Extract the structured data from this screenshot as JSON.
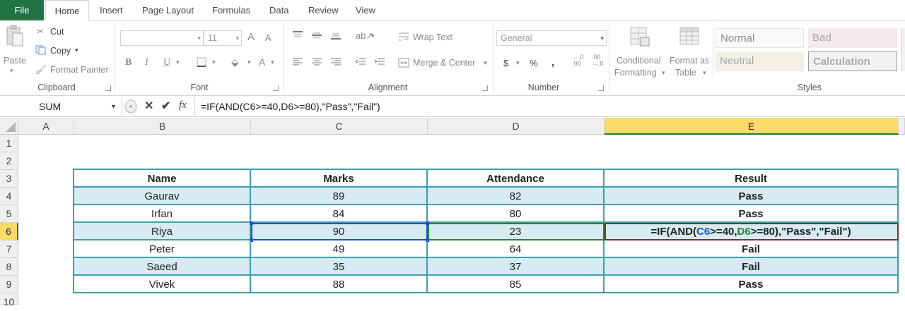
{
  "tabs": {
    "file": "File",
    "home": "Home",
    "insert": "Insert",
    "page_layout": "Page Layout",
    "formulas": "Formulas",
    "data": "Data",
    "review": "Review",
    "view": "View"
  },
  "ribbon": {
    "clipboard": {
      "paste": "Paste",
      "cut": "Cut",
      "copy": "Copy",
      "format_painter": "Format Painter",
      "label": "Clipboard"
    },
    "font": {
      "font_size": "11",
      "grow": "A",
      "shrink": "A",
      "bold": "B",
      "italic": "I",
      "underline": "U",
      "font_color": "A",
      "label": "Font"
    },
    "alignment": {
      "wrap_text": "Wrap Text",
      "merge_center": "Merge & Center",
      "label": "Alignment"
    },
    "number": {
      "format": "General",
      "currency": "$",
      "percent": "%",
      "comma": ",",
      "increase_decimal": "←.0\n.00",
      "decrease_decimal": ".00\n→.0",
      "label": "Number"
    },
    "styles": {
      "conditional_formatting_1": "Conditional",
      "conditional_formatting_2": "Formatting",
      "format_as_table_1": "Format as",
      "format_as_table_2": "Table",
      "normal": "Normal",
      "bad": "Bad",
      "neutral": "Neutral",
      "calculation": "Calculation",
      "label": "Styles"
    }
  },
  "formula_bar": {
    "name_box": "SUM",
    "fx": "fx",
    "formula": "=IF(AND(C6>=40,D6>=80),\"Pass\",\"Fail\")"
  },
  "columns": [
    "A",
    "B",
    "C",
    "D",
    "E"
  ],
  "rows": [
    "1",
    "2",
    "3",
    "4",
    "5",
    "6",
    "7",
    "8",
    "9",
    "10"
  ],
  "table": {
    "headers": [
      "Name",
      "Marks",
      "Attendance",
      "Result"
    ],
    "rows": [
      [
        "Gaurav",
        "89",
        "82",
        "Pass"
      ],
      [
        "Irfan",
        "84",
        "80",
        "Pass"
      ],
      [
        "Riya",
        "90",
        "23",
        ""
      ],
      [
        "Peter",
        "49",
        "64",
        "Fail"
      ],
      [
        "Saeed",
        "35",
        "37",
        "Fail"
      ],
      [
        "Vivek",
        "88",
        "85",
        "Pass"
      ]
    ]
  },
  "edit_cell": {
    "part1": "=IF(AND(",
    "ref1": "C6",
    "part2": ">=40,",
    "ref2": "D6",
    "part3": ">=80)",
    "part4": ",\"Pass\",\"Fail\")"
  },
  "colors": {
    "file_tab": "#217346",
    "table_shade": "#d6ebf2",
    "table_border": "#3c9fae",
    "ref_c6": "#1f4fd6",
    "ref_d6": "#1e8a2e",
    "selected_header": "#f9dc67"
  }
}
